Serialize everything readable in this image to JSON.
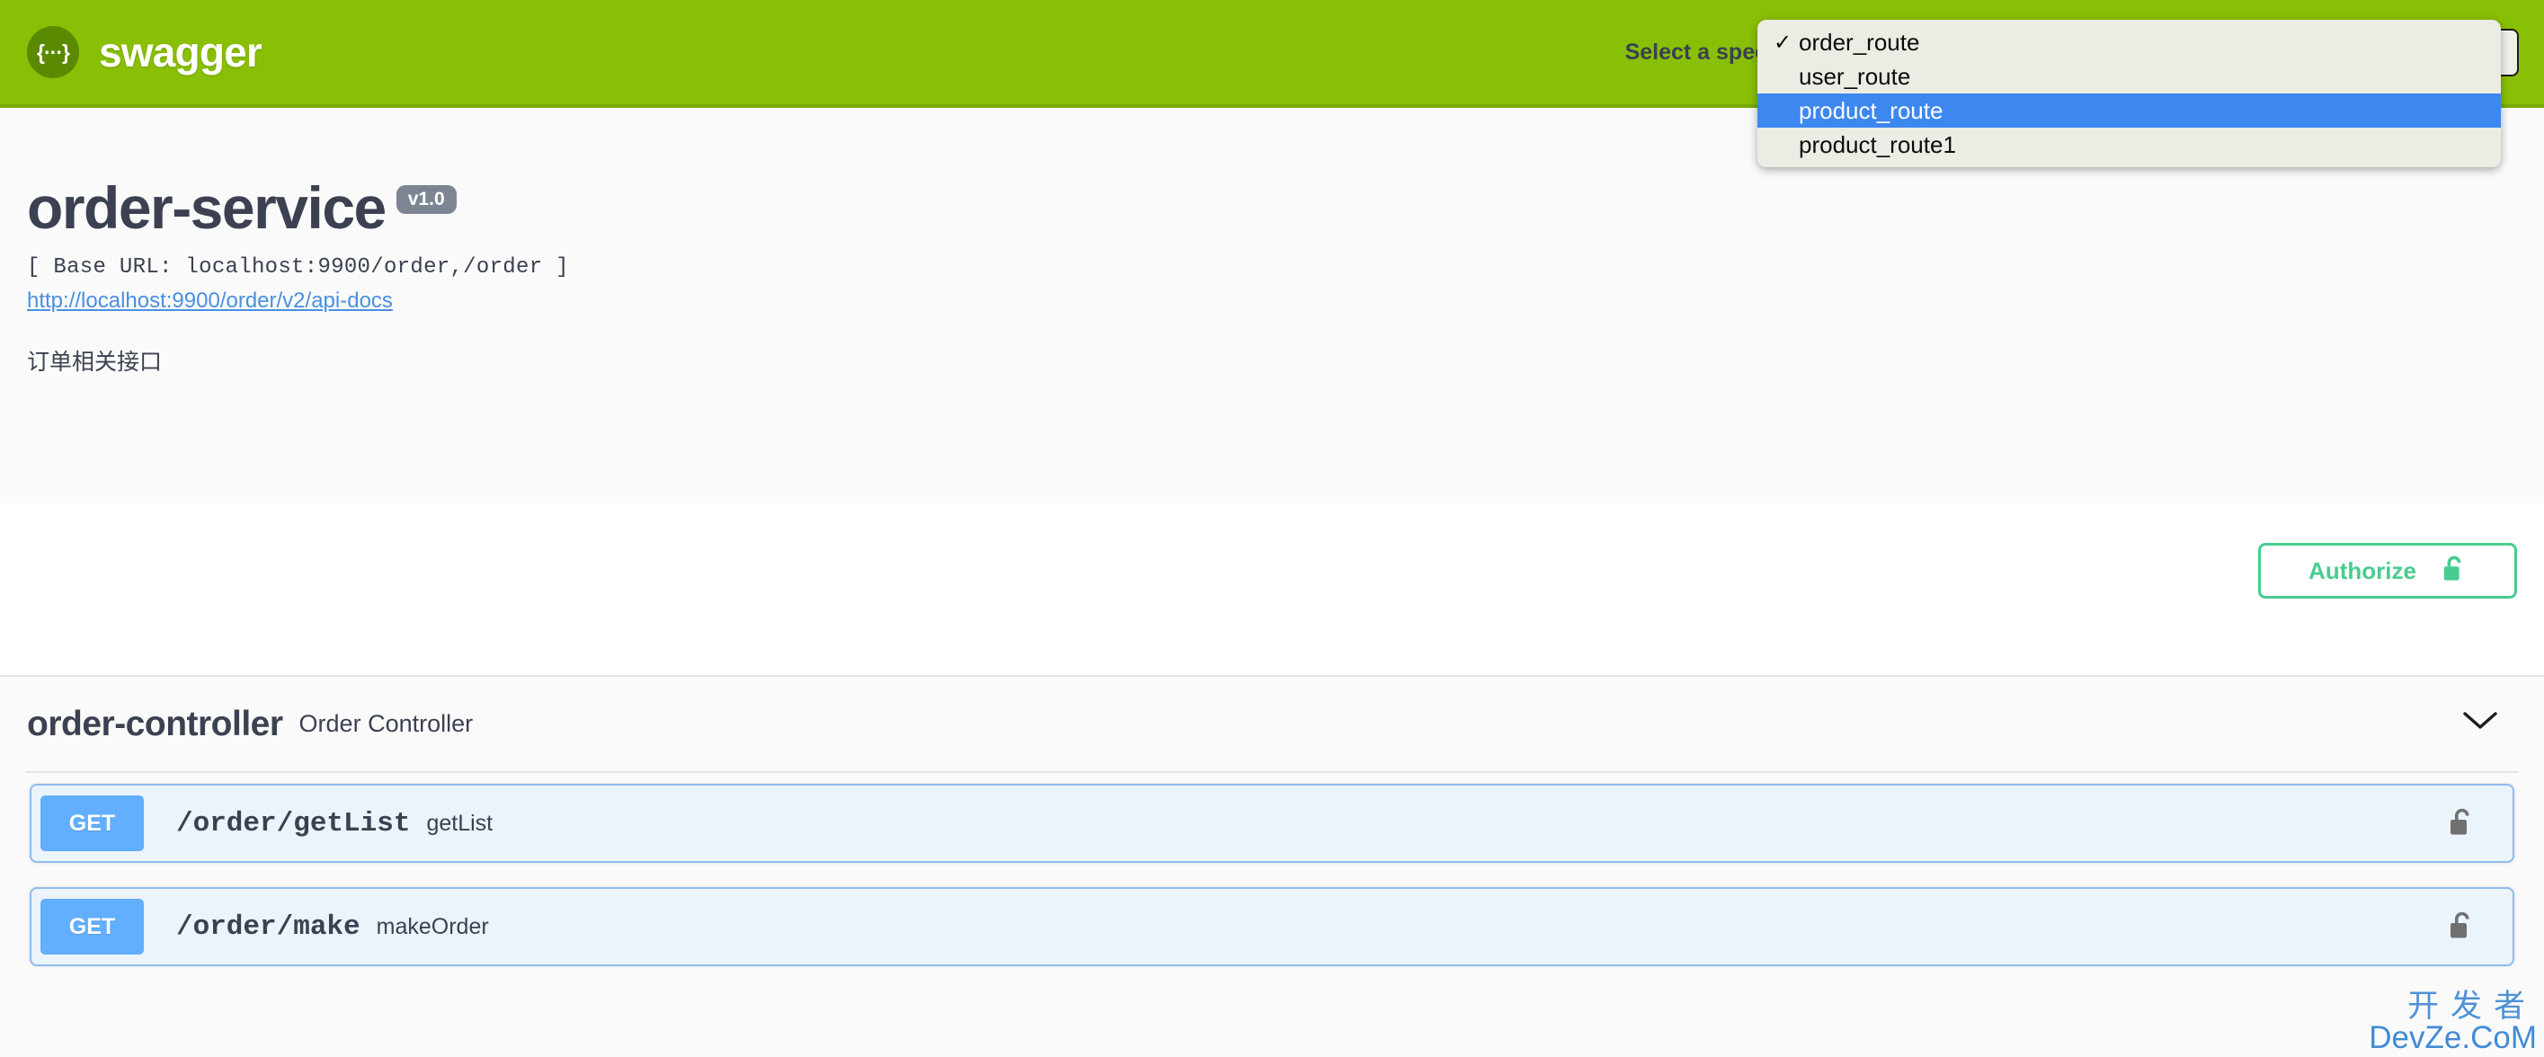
{
  "topbar": {
    "logo_text": "swagger",
    "logo_icon": "swagger-braces-icon",
    "spec_label": "Select a spec"
  },
  "spec_dropdown": {
    "selected": "order_route",
    "highlighted": "product_route",
    "check_glyph": "✓",
    "options": [
      {
        "label": "order_route",
        "checked": true,
        "highlighted": false
      },
      {
        "label": "user_route",
        "checked": false,
        "highlighted": false
      },
      {
        "label": "product_route",
        "checked": false,
        "highlighted": true
      },
      {
        "label": "product_route1",
        "checked": false,
        "highlighted": false
      }
    ]
  },
  "info": {
    "title": "order-service",
    "version": "v1.0",
    "base_url": "[ Base URL: localhost:9900/order,/order ]",
    "docs_link": "http://localhost:9900/order/v2/api-docs",
    "description": "订单相关接口"
  },
  "authorize": {
    "label": "Authorize",
    "icon": "unlock-icon"
  },
  "tag": {
    "name": "order-controller",
    "description": "Order Controller",
    "collapse_icon": "chevron-down-icon"
  },
  "operations": [
    {
      "method": "GET",
      "path": "/order/getList",
      "summary": "getList",
      "lock_icon": "unlock-icon"
    },
    {
      "method": "GET",
      "path": "/order/make",
      "summary": "makeOrder",
      "lock_icon": "unlock-icon"
    }
  ],
  "watermark": {
    "line1": "开发者",
    "line2": "DevZe.CoM"
  },
  "colors": {
    "brand_green": "#89bf04",
    "get_blue": "#61affe",
    "authorize_green": "#49cc90",
    "highlight_blue": "#3c87f0",
    "text_dark": "#3b4151"
  }
}
